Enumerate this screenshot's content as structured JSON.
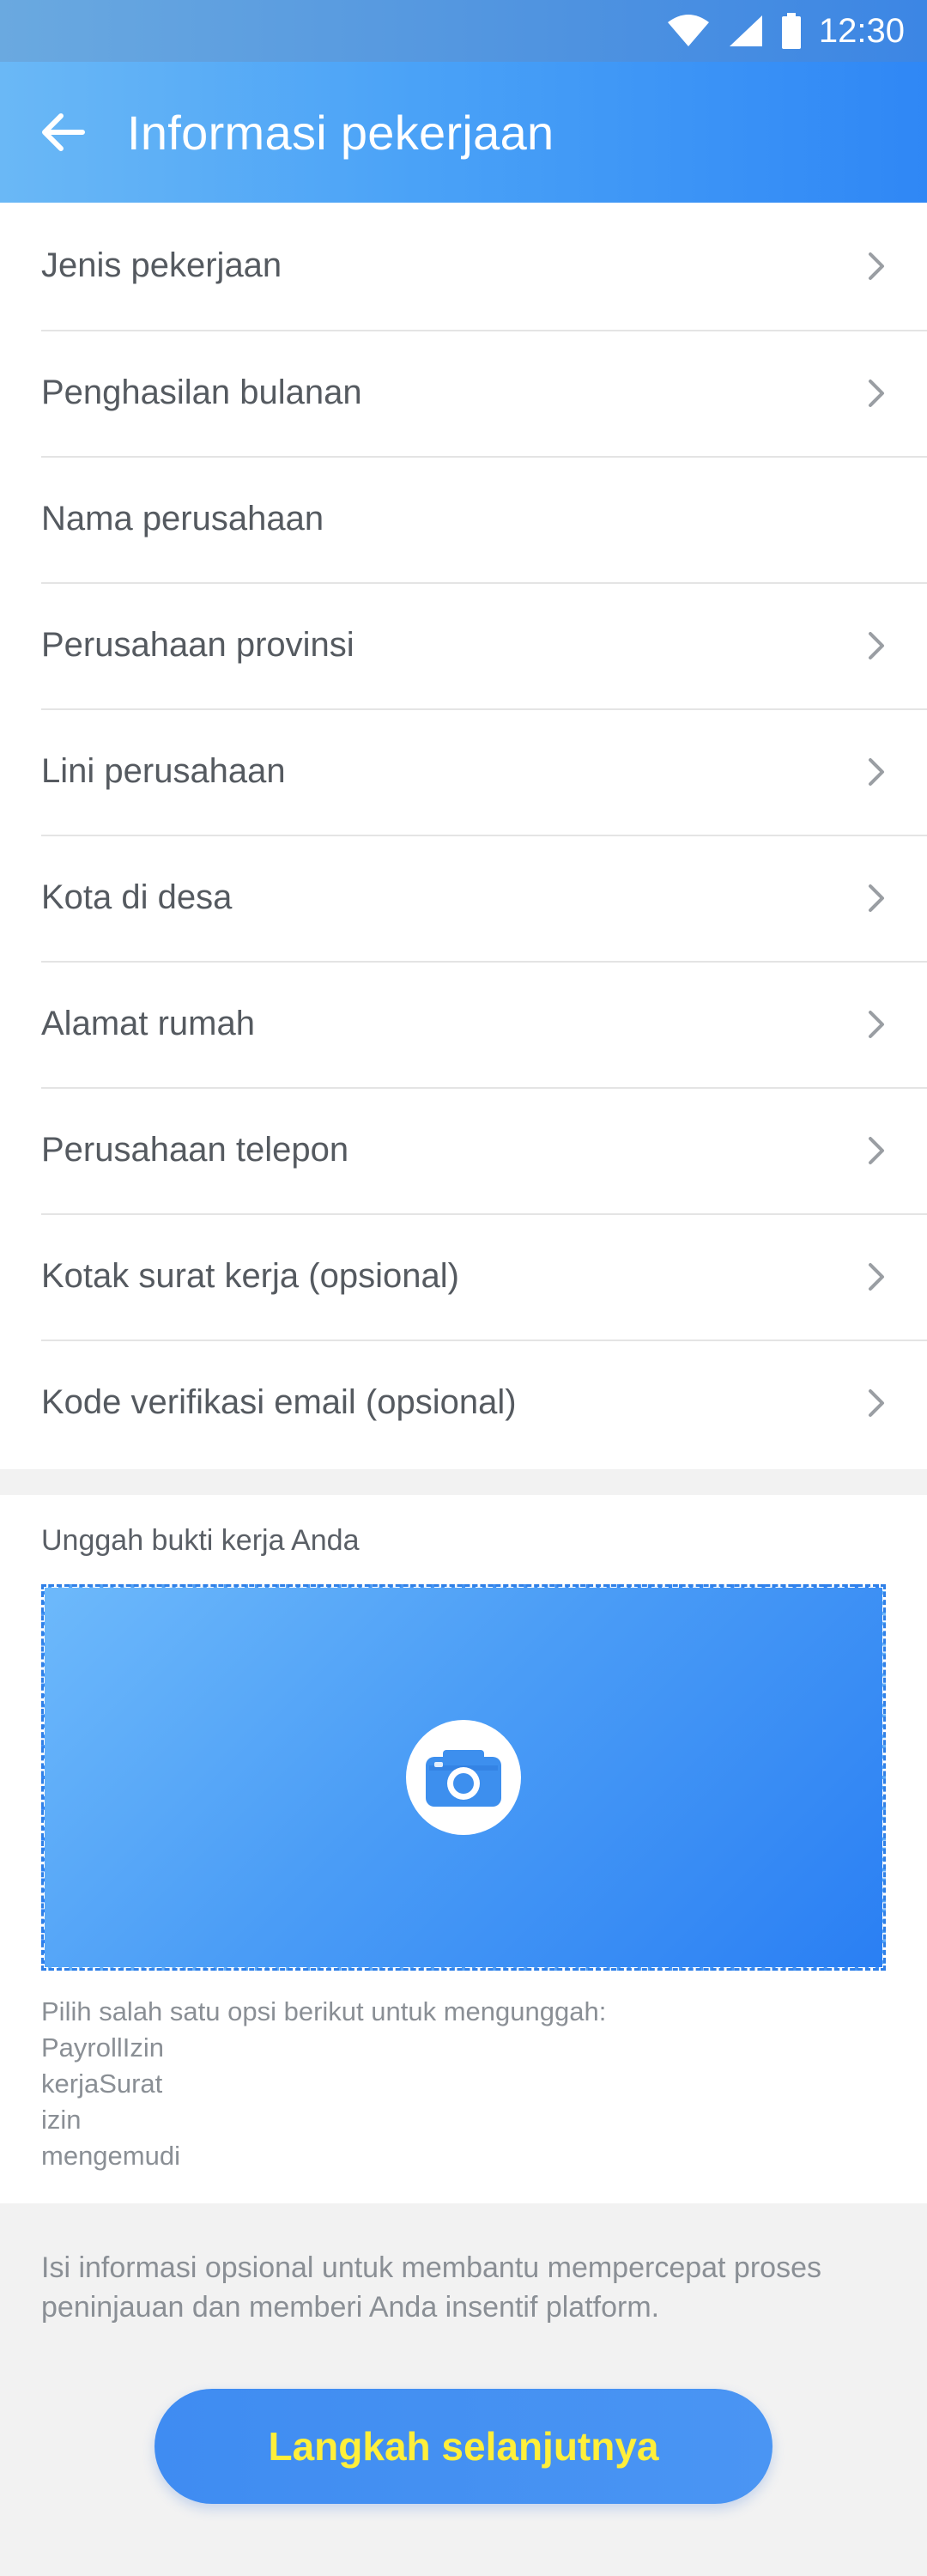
{
  "status_bar": {
    "time": "12:30",
    "icons": [
      "wifi-icon",
      "cell-signal-icon",
      "battery-icon"
    ]
  },
  "app_bar": {
    "title": "Informasi pekerjaan",
    "back_icon": "arrow-left-icon"
  },
  "form": {
    "rows": [
      {
        "label": "Jenis pekerjaan",
        "chevron": true
      },
      {
        "label": "Penghasilan bulanan",
        "chevron": true
      },
      {
        "label": "Nama perusahaan",
        "chevron": false
      },
      {
        "label": "Perusahaan provinsi",
        "chevron": true
      },
      {
        "label": "Lini perusahaan",
        "chevron": true
      },
      {
        "label": "Kota di desa",
        "chevron": true
      },
      {
        "label": "Alamat rumah",
        "chevron": true
      },
      {
        "label": "Perusahaan telepon",
        "chevron": true
      },
      {
        "label": "Kotak surat kerja (opsional)",
        "chevron": true
      },
      {
        "label": "Kode verifikasi email (opsional)",
        "chevron": true
      }
    ]
  },
  "upload": {
    "title": "Unggah bukti kerja Anda",
    "icon": "camera-icon",
    "instructions": [
      "Pilih salah satu opsi berikut untuk mengunggah:",
      "PayrollIzin",
      "kerjaSurat",
      "izin",
      "mengemudi"
    ]
  },
  "footer": {
    "info": "Isi informasi opsional untuk membantu mempercepat proses peninjauan dan memberi Anda insentif platform.",
    "next_label": "Langkah selanjutnya"
  },
  "colors": {
    "accent": "#3f8cf2",
    "button_text": "#ffef3a",
    "app_bar_start": "#6ab8f6",
    "app_bar_end": "#2f87f5"
  }
}
